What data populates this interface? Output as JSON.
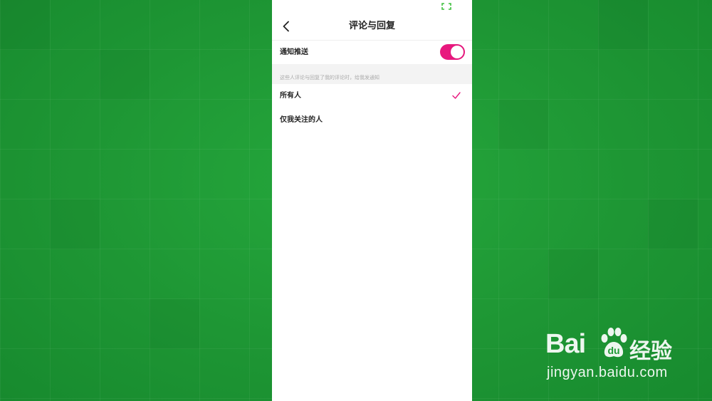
{
  "nav": {
    "title": "评论与回复",
    "back_icon": "chevron-left-icon"
  },
  "notify": {
    "label": "通知推送",
    "toggle_on": true,
    "toggle_color": "#e8187e"
  },
  "section_hint": "这些人评论与回复了我的评论时，给我发通知",
  "options": [
    {
      "label": "所有人",
      "selected": true
    },
    {
      "label": "仅我关注的人",
      "selected": false
    }
  ],
  "check_color": "#e8187e",
  "watermark": {
    "brand_latin": "Bai",
    "brand_cn": "经验",
    "url": "jingyan.baidu.com"
  },
  "colors": {
    "background_green": "#1f9a35",
    "status_icon_green": "#3fbf3f"
  }
}
